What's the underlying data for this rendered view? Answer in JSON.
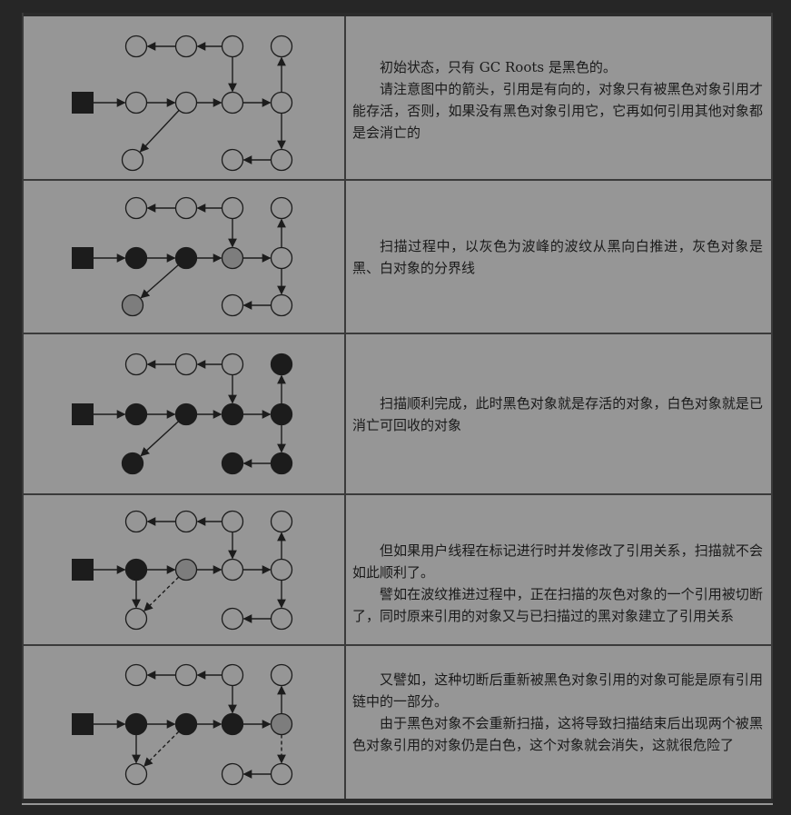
{
  "colors": {
    "background": "#262626",
    "table_fill": "#969696",
    "white_object": "#969696",
    "gray_object": "#7d7d7d",
    "black_object": "#1c1c1c",
    "stroke": "#1c1c1c"
  },
  "rows": [
    {
      "paragraphs": [
        "初始状态，只有 GC Roots 是黑色的。",
        "请注意图中的箭头，引用是有向的，对象只有被黑色对象引用才能存活，否则，如果没有黑色对象引用它，它再如何引用其他对象都是会消亡的"
      ],
      "node_states": {
        "c": "white",
        "d": "white",
        "e": "white",
        "f": "white",
        "g": "white",
        "h": "white",
        "i": "white",
        "j": "white",
        "k": "white",
        "l": "white",
        "m": "white"
      }
    },
    {
      "paragraphs": [
        "扫描过程中，以灰色为波峰的波纹从黑向白推进，灰色对象是黑、白对象的分界线"
      ],
      "node_states": {
        "c": "white",
        "d": "white",
        "e": "white",
        "f": "white",
        "g": "black",
        "h": "black",
        "i": "gray",
        "j": "white",
        "k": "gray",
        "l": "white",
        "m": "white"
      }
    },
    {
      "paragraphs": [
        "扫描顺利完成，此时黑色对象就是存活的对象，白色对象就是已消亡可回收的对象"
      ],
      "node_states": {
        "c": "white",
        "d": "white",
        "e": "white",
        "f": "black",
        "g": "black",
        "h": "black",
        "i": "black",
        "j": "black",
        "k": "black",
        "l": "black",
        "m": "black"
      }
    },
    {
      "paragraphs": [
        "但如果用户线程在标记进行时并发修改了引用关系，扫描就不会如此顺利了。",
        "譬如在波纹推进过程中，正在扫描的灰色对象的一个引用被切断了，同时原来引用的对象又与已扫描过的黑对象建立了引用关系"
      ],
      "node_states": {
        "c": "white",
        "d": "white",
        "e": "white",
        "f": "white",
        "g": "black",
        "h": "gray",
        "i": "white",
        "j": "white",
        "k": "white",
        "l": "white",
        "m": "white"
      }
    },
    {
      "paragraphs": [
        "又譬如，这种切断后重新被黑色对象引用的对象可能是原有引用链中的一部分。",
        "由于黑色对象不会重新扫描，这将导致扫描结束后出现两个被黑色对象引用的对象仍是白色，这个对象就会消失，这就很危险了"
      ],
      "node_states": {
        "c": "white",
        "d": "white",
        "e": "white",
        "f": "white",
        "g": "black",
        "h": "black",
        "i": "black",
        "j": "gray",
        "k": "white",
        "l": "white",
        "m": "white"
      }
    }
  ]
}
